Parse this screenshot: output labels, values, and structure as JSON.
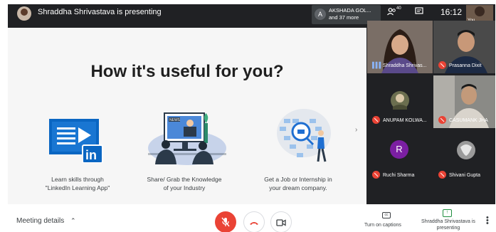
{
  "top_bar": {
    "presenting_text": "Shraddha Shrivastava is presenting",
    "pinned_chip": {
      "avatar_letter": "A",
      "line1": "AKSHADA GOL...",
      "line2": "and 37 more"
    },
    "people_count": "40",
    "clock": "16:12",
    "self_tile_label": "You"
  },
  "slide": {
    "title": "How it's useful for you?",
    "items": [
      {
        "caption_line1": "Learn skills through",
        "caption_line2": "\"LinkedIn Learning App\"",
        "logo_text": "in"
      },
      {
        "caption_line1": "Share/ Grab the Knowledge",
        "caption_line2": "of your Industry",
        "news_label": "NEWS"
      },
      {
        "caption_line1": "Get a Job or Internship in",
        "caption_line2": "your dream company."
      }
    ],
    "next_arrow": "›"
  },
  "participants": [
    {
      "name": "Shraddha Shrivas...",
      "mic": "on"
    },
    {
      "name": "Prasanna Dixit",
      "mic": "off"
    },
    {
      "name": "ANUPAM KOLWA...",
      "mic": "off"
    },
    {
      "name": "CASUMANK JHA",
      "mic": "off"
    },
    {
      "name": "Ruchi Sharma",
      "mic": "off",
      "avatar_letter": "R",
      "avatar_color": "#7b1fa2"
    },
    {
      "name": "Shivani Gupta",
      "mic": "off"
    }
  ],
  "bottom_bar": {
    "meeting_details": "Meeting details",
    "captions_label": "Turn on captions",
    "cc_icon": "cc",
    "presenting_label": "Shraddha Shrivastava is presenting"
  },
  "colors": {
    "end_call": "#ea4335",
    "mic_off": "#ea4335",
    "presenting": "#1e8e3e",
    "linkedin_blue": "#0a66c2"
  }
}
